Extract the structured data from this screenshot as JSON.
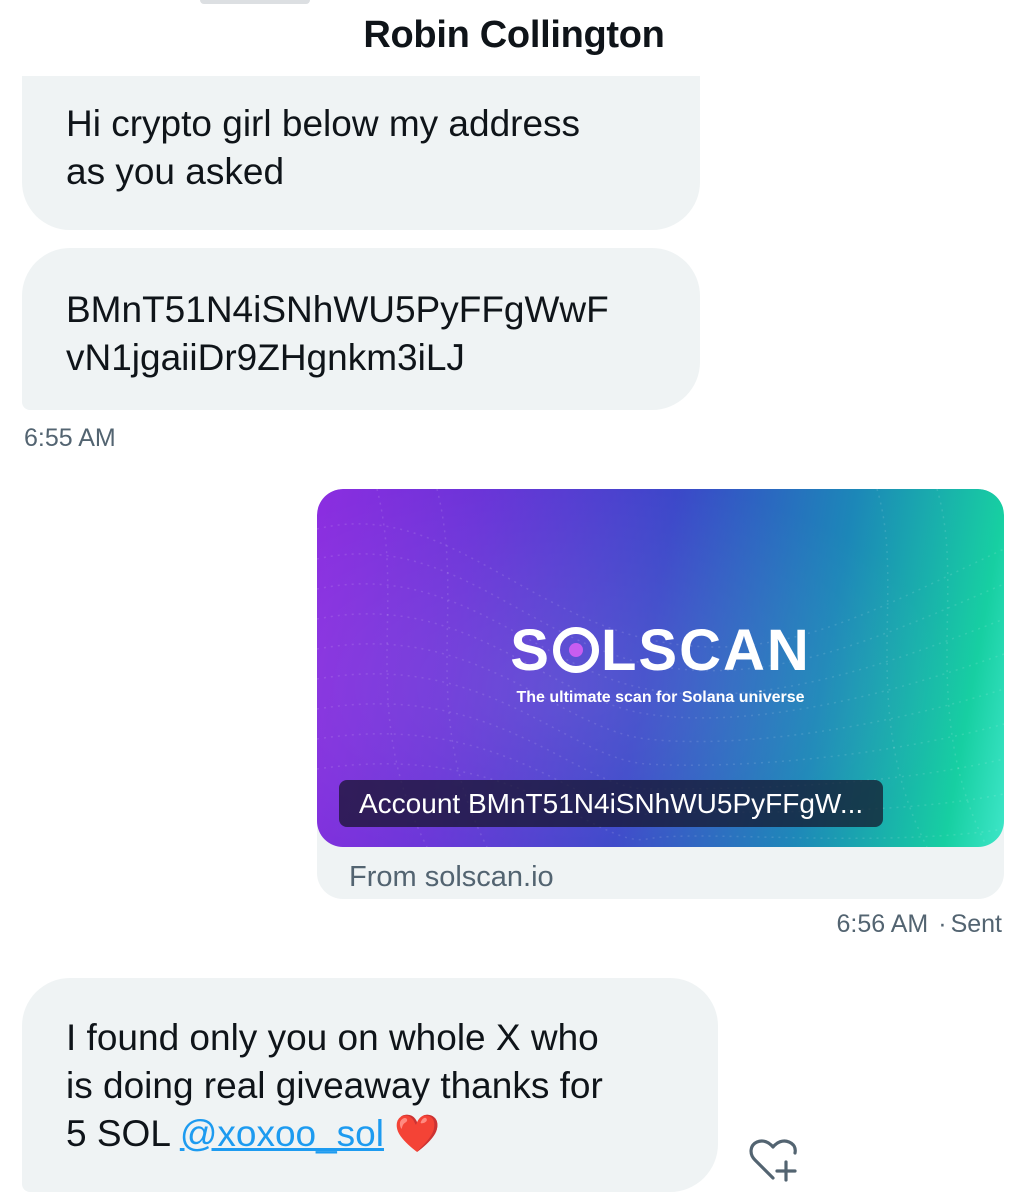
{
  "header": {
    "title": "Robin Collington"
  },
  "messages": [
    {
      "lines": [
        "Hi crypto girl below my address",
        "as you asked"
      ]
    },
    {
      "lines": [
        "BMnT51N4iSNhWU5PyFFgWwF",
        "vN1jgaiiDr9ZHgnkm3iLJ"
      ],
      "time": "6:55 AM"
    },
    {
      "card": {
        "brand": "SOLSCAN",
        "brand_prefix": "S",
        "brand_suffix": "LSCAN",
        "tagline": "The ultimate scan for Solana universe",
        "account": "Account BMnT51N4iSNhWU5PyFFgW...",
        "source": "From solscan.io"
      },
      "time": "6:56 AM",
      "status": "Sent"
    },
    {
      "lines": [
        "I found only you on whole X who",
        "is doing real giveaway thanks for"
      ],
      "line3_prefix": "5 SOL ",
      "mention": "@xoxoo_sol",
      "emoji": "❤️"
    }
  ],
  "react_button": {
    "icon": "heart-plus-icon"
  },
  "colors": {
    "bubble_bg": "#eff3f4",
    "meta_text": "#536471",
    "link": "#1d9bf0",
    "heart": "#f4212e"
  }
}
